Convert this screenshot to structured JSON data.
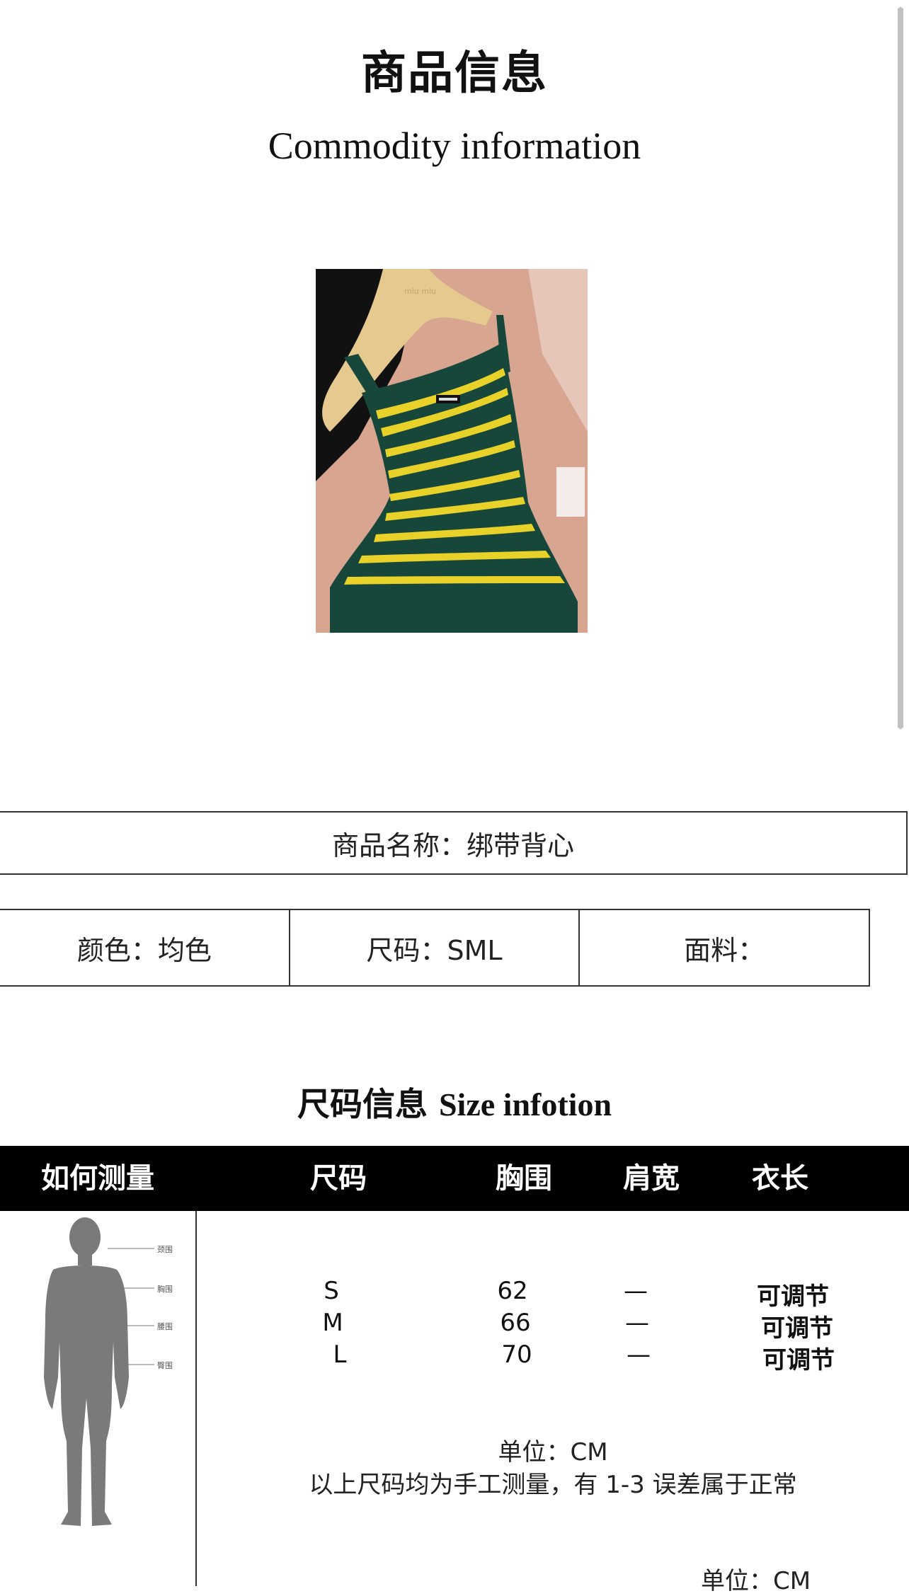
{
  "header": {
    "title_cn": "商品信息",
    "title_en": "Commodity information"
  },
  "product_image": {
    "logo_text": "miu miu",
    "colors": {
      "green": "#17473a",
      "yellow": "#e8d22a",
      "hanger": "#e3c88e"
    }
  },
  "info": {
    "name_label": "商品名称：绑带背心",
    "color_label": "颜色：均色",
    "size_label": "尺码：SML",
    "fabric_label": "面料："
  },
  "size_section": {
    "heading_cn": "尺码信息",
    "heading_en": "Size infotion",
    "columns": [
      "如何测量",
      "尺码",
      "胸围",
      "肩宽",
      "衣长"
    ],
    "rows": [
      {
        "size": "S",
        "chest": "62",
        "shoulder": "—",
        "length": "可调节"
      },
      {
        "size": "M",
        "chest": "66",
        "shoulder": "—",
        "length": "可调节"
      },
      {
        "size": "L",
        "chest": "70",
        "shoulder": "—",
        "length": "可调节"
      }
    ],
    "unit": "单位：CM",
    "note": "以上尺码均为手工测量，有 1-3 误差属于正常",
    "unit_bottom": "单位：CM",
    "figure_labels": [
      "颈围",
      "胸围",
      "腰围",
      "臀围"
    ]
  }
}
